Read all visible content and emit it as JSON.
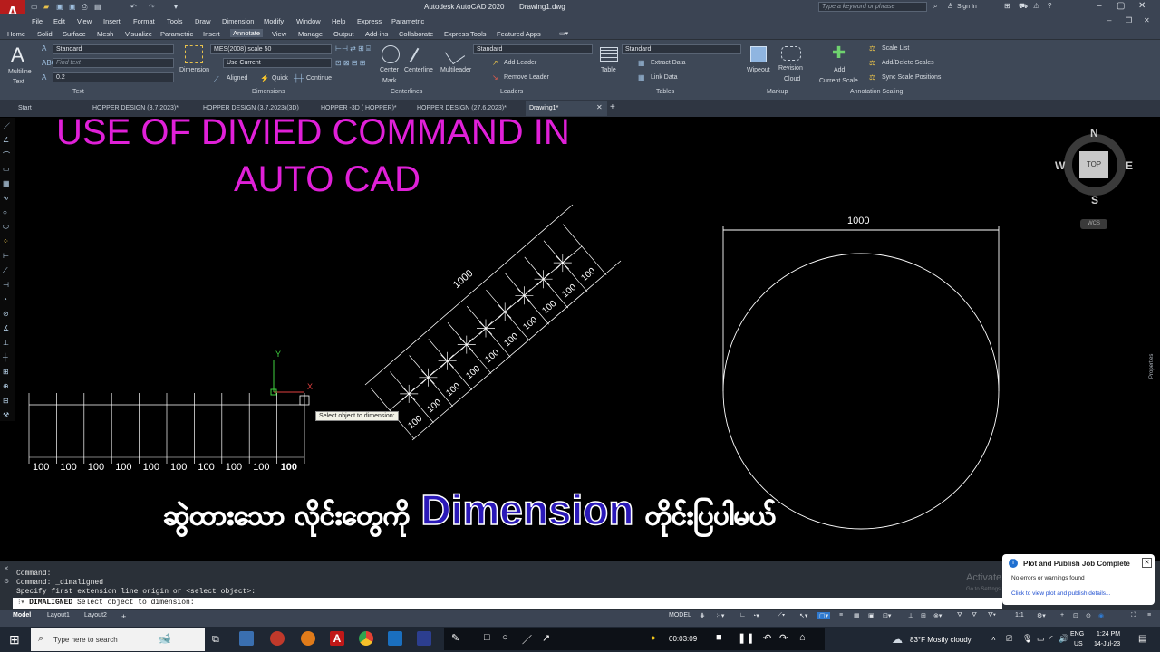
{
  "app": {
    "title": "Autodesk AutoCAD 2020",
    "document": "Drawing1.dwg",
    "search_placeholder": "Type a keyword or phrase",
    "sign_in": "Sign In",
    "logo": "A"
  },
  "menus": [
    "File",
    "Edit",
    "View",
    "Insert",
    "Format",
    "Tools",
    "Draw",
    "Dimension",
    "Modify",
    "Window",
    "Help",
    "Express",
    "Parametric"
  ],
  "ribbon_tabs": [
    "Home",
    "Solid",
    "Surface",
    "Mesh",
    "Visualize",
    "Parametric",
    "Insert",
    "Annotate",
    "View",
    "Manage",
    "Output",
    "Add-ins",
    "Collaborate",
    "Express Tools",
    "Featured Apps"
  ],
  "active_ribbon_tab": "Annotate",
  "ribbon": {
    "text": {
      "multiline": "Multiline",
      "multiline2": "Text",
      "style": "Standard",
      "find_placeholder": "Find text",
      "height": "0.2",
      "panel": "Text"
    },
    "dimensions": {
      "button": "Dimension",
      "style": "MES(2008) scale 50",
      "layer": "Use Current",
      "aligned": "Aligned",
      "quick": "Quick",
      "continue": "Continue",
      "panel": "Dimensions"
    },
    "centerlines": {
      "center_mark": "Center",
      "center_mark2": "Mark",
      "centerline": "Centerline",
      "panel": "Centerlines"
    },
    "leaders": {
      "multileader": "Multileader",
      "style": "Standard",
      "add": "Add Leader",
      "remove": "Remove Leader",
      "panel": "Leaders"
    },
    "tables": {
      "table": "Table",
      "style": "Standard",
      "extract": "Extract Data",
      "link": "Link Data",
      "panel": "Tables"
    },
    "markup": {
      "wipeout": "Wipeout",
      "revision": "Revision",
      "revision2": "Cloud",
      "panel": "Markup"
    },
    "scaling": {
      "add": "Add",
      "current": "Current Scale",
      "scale_list": "Scale List",
      "add_delete": "Add/Delete Scales",
      "sync": "Sync Scale Positions",
      "panel": "Annotation Scaling"
    }
  },
  "file_tabs": [
    "Start",
    "HOPPER DESIGN (3.7.2023)*",
    "HOPPER DESIGN (3.7.2023)(3D)",
    "HOPPER -3D ( HOPPER)*",
    "HOPPER DESIGN (27.6.2023)*",
    "Drawing1*"
  ],
  "active_file_tab": "Drawing1*",
  "overlay": {
    "title_line1": "USE OF DIVIED COMMAND IN",
    "title_line2": "AUTO CAD",
    "burmese_prefix": "ဆွဲထားသော လိုင်းတွေကို",
    "burmese_word": "Dimension",
    "burmese_suffix": "တိုင်းပြပါမယ်"
  },
  "drawing": {
    "horizontal_labels": [
      "100",
      "100",
      "100",
      "100",
      "100",
      "100",
      "100",
      "100",
      "100",
      "100"
    ],
    "diagonal_labels": [
      "100",
      "100",
      "100",
      "100",
      "100",
      "100",
      "100",
      "100",
      "100",
      "100"
    ],
    "diagonal_total": "1000",
    "circle_total": "1000",
    "ucs_x": "X",
    "ucs_y": "Y",
    "tooltip": "Select object to dimension:"
  },
  "viewcube": {
    "n": "N",
    "s": "S",
    "e": "E",
    "w": "W",
    "top": "TOP",
    "wcs": "WCS"
  },
  "properties_label": "Properties",
  "command": {
    "history": [
      "Command:",
      "Command: _dimaligned",
      "Specify first extension line origin or <select object>:"
    ],
    "prompt_cmd": "DIMALIGNED",
    "prompt_text": "Select object to dimension:"
  },
  "layouts": [
    "Model",
    "Layout1",
    "Layout2"
  ],
  "status": {
    "model": "MODEL",
    "scale": "1:1"
  },
  "notification": {
    "title": "Plot and Publish Job Complete",
    "body": "No errors or warnings found",
    "link": "Click to view plot and publish details..."
  },
  "watermark": {
    "line1": "Activate Windows",
    "line2": "Go to Settings to activate Windows."
  },
  "taskbar": {
    "search_placeholder": "Type here to search",
    "timer": "00:03:09",
    "weather": "83°F  Mostly cloudy",
    "lang": "ENG",
    "region": "US",
    "time": "1:24 PM",
    "date": "14-Jul-23"
  }
}
